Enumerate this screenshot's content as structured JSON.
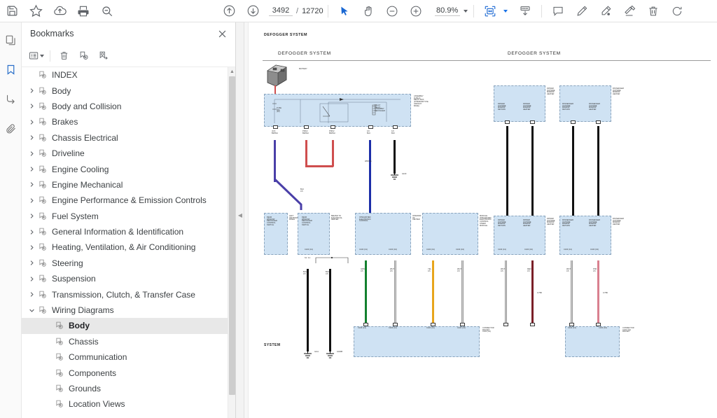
{
  "app": {
    "toolbar": {
      "left_buttons": [
        {
          "name": "save-icon",
          "label": "Save"
        },
        {
          "name": "star-icon",
          "label": "Add to favorites"
        },
        {
          "name": "cloud-upload-icon",
          "label": "Upload"
        },
        {
          "name": "print-icon",
          "label": "Print"
        },
        {
          "name": "search-minus-icon",
          "label": "Search"
        }
      ],
      "nav": {
        "previous_page_icon": "arrow-up-circle-icon",
        "next_page_icon": "arrow-down-circle-icon",
        "current_page": "3492",
        "separator": "/",
        "total_pages": "12720"
      },
      "tools": [
        {
          "name": "select-cursor-icon",
          "label": "Select"
        },
        {
          "name": "hand-pan-icon",
          "label": "Pan"
        },
        {
          "name": "zoom-out-icon",
          "label": "Zoom out"
        },
        {
          "name": "zoom-in-icon",
          "label": "Zoom in"
        }
      ],
      "zoom": {
        "value": "80.9%",
        "dropdown_icon": "chevron-down-icon"
      },
      "fit": {
        "name": "fit-page-icon",
        "label": "Fit page",
        "dropdown_icon": "chevron-down-icon"
      },
      "right_buttons": [
        {
          "name": "page-layout-icon",
          "label": "Page layout"
        },
        {
          "name": "comment-icon",
          "label": "Comment"
        },
        {
          "name": "highlight-pen-icon",
          "label": "Highlight"
        },
        {
          "name": "ink-pen-icon",
          "label": "Draw"
        },
        {
          "name": "stamp-icon",
          "label": "Stamp"
        },
        {
          "name": "trash-icon",
          "label": "Delete"
        },
        {
          "name": "rotate-icon",
          "label": "Rotate"
        }
      ]
    },
    "rail": [
      {
        "name": "rail-pages",
        "icon": "pages-icon",
        "active": false
      },
      {
        "name": "rail-bookmarks",
        "icon": "bookmark-icon",
        "active": true
      },
      {
        "name": "rail-signature",
        "icon": "signature-icon",
        "active": false
      },
      {
        "name": "rail-attachments",
        "icon": "paperclip-icon",
        "active": false
      }
    ],
    "panel": {
      "title": "Bookmarks",
      "close_icon": "close-icon",
      "tools": [
        {
          "name": "bookmark-options-icon",
          "label": "Options"
        },
        {
          "name": "delete-bookmark-icon",
          "label": "Delete bookmark"
        },
        {
          "name": "add-bookmark-icon",
          "label": "Add bookmark"
        },
        {
          "name": "goto-bookmark-icon",
          "label": "Go to bookmark"
        }
      ],
      "items": [
        {
          "label": "INDEX",
          "depth": 0,
          "expandable": false,
          "expanded": false,
          "selected": false
        },
        {
          "label": "Body",
          "depth": 0,
          "expandable": true,
          "expanded": false,
          "selected": false
        },
        {
          "label": "Body and Collision",
          "depth": 0,
          "expandable": true,
          "expanded": false,
          "selected": false
        },
        {
          "label": "Brakes",
          "depth": 0,
          "expandable": true,
          "expanded": false,
          "selected": false
        },
        {
          "label": "Chassis Electrical",
          "depth": 0,
          "expandable": true,
          "expanded": false,
          "selected": false
        },
        {
          "label": "Driveline",
          "depth": 0,
          "expandable": true,
          "expanded": false,
          "selected": false
        },
        {
          "label": "Engine Cooling",
          "depth": 0,
          "expandable": true,
          "expanded": false,
          "selected": false
        },
        {
          "label": "Engine Mechanical",
          "depth": 0,
          "expandable": true,
          "expanded": false,
          "selected": false
        },
        {
          "label": "Engine Performance & Emission Controls",
          "depth": 0,
          "expandable": true,
          "expanded": false,
          "selected": false
        },
        {
          "label": "Fuel System",
          "depth": 0,
          "expandable": true,
          "expanded": false,
          "selected": false
        },
        {
          "label": "General Information & Identification",
          "depth": 0,
          "expandable": true,
          "expanded": false,
          "selected": false
        },
        {
          "label": "Heating, Ventilation, & Air Conditioning",
          "depth": 0,
          "expandable": true,
          "expanded": false,
          "selected": false
        },
        {
          "label": "Steering",
          "depth": 0,
          "expandable": true,
          "expanded": false,
          "selected": false
        },
        {
          "label": "Suspension",
          "depth": 0,
          "expandable": true,
          "expanded": false,
          "selected": false
        },
        {
          "label": "Transmission, Clutch, & Transfer Case",
          "depth": 0,
          "expandable": true,
          "expanded": false,
          "selected": false
        },
        {
          "label": "Wiring Diagrams",
          "depth": 0,
          "expandable": true,
          "expanded": true,
          "selected": false
        },
        {
          "label": "Body",
          "depth": 1,
          "expandable": false,
          "expanded": false,
          "selected": true
        },
        {
          "label": "Chassis",
          "depth": 1,
          "expandable": false,
          "expanded": false,
          "selected": false
        },
        {
          "label": "Communication",
          "depth": 1,
          "expandable": false,
          "expanded": false,
          "selected": false
        },
        {
          "label": "Components",
          "depth": 1,
          "expandable": false,
          "expanded": false,
          "selected": false
        },
        {
          "label": "Grounds",
          "depth": 1,
          "expandable": false,
          "expanded": false,
          "selected": false
        },
        {
          "label": "Location Views",
          "depth": 1,
          "expandable": false,
          "expanded": false,
          "selected": false
        }
      ]
    },
    "splitter": {
      "collapse_icon": "collapse-left-icon"
    },
    "document": {
      "running_head": "DEFOGGER SYSTEM",
      "section_title_left": "DEFOGGER SYSTEM",
      "section_title_right": "DEFOGGER SYSTEM",
      "footer": "SYSTEM",
      "labels": {
        "battery": "BATTERY",
        "fuse_box": "ASSEMBLY\nFUSE &\nRELAY BOX\n(INTERIOR/TYPE\nVARIANT\nBASE)",
        "relay_block": "RELAY\nRELAY\nASSEMBLY\nDEFOGGER",
        "fuse_left": "FUSE\n30A\n(10)",
        "pin_a1": "(1/3)\nBR/WH",
        "pin_a2": "PNK/2\nBR/WH",
        "pin_a3": "PNK/2\nBR/WH",
        "pin_b1": "1/C\nBLU",
        "pin_b2": "1/C\nBLK",
        "splice_s1": "S1  3-1",
        "splice_label": "SPLICE",
        "gnd_main": "G100",
        "module_1": "REAR\nWINDOW\nDEFOGGER\nCONTROL\nSWITCH",
        "module_1b": "LEFT\nINSTRUMENT\nPANEL",
        "module_2": "REAR\nWINDOW\nDEFOGGER\nCONTROL\nSWITCH",
        "module_2b": "BEHIND TO\nELECTRICAL\nHEATER",
        "module_3": "INTEGRATED\nELECTRONIC\nCONTROL",
        "module_3b": "INTERIOR\nOF\nCENTER",
        "module_4": "MODULE\nINTEGRATED\nELECTRONIC\nCONTROL\nSTEER\nMODULE",
        "module_5": "DRIVER\nOUTSIDE\nMIRROR\nHEATER",
        "module_5a": "DRIVER\nOUTSIDE\nMIRROR\nRETURN",
        "module_5b": "DRIVER\nOUTSIDE\nMIRROR\nHEATER",
        "module_6": "PASSENGER\nOUTSIDE\nMIRROR\nHEATER",
        "module_6a": "PASSENGER\nOUTSIDE\nMIRROR\nRETURN",
        "module_6b": "PASSENGER\nOUTSIDE\nMIRROR\nHEATER",
        "connector_c1": "C100 (C1)",
        "connector_c2": "C100 (C2)",
        "connector_panel_left": "CONNECTOR\nPACKET\nC100 (C4)",
        "connector_panel_right": "CONNECTOR\nC100 (C4)\nPACKET",
        "wire_green": "GRN\n0.5",
        "wire_white": "WHT\n0.5",
        "wire_yellow": "YEL\n0.5",
        "wire_red": "RED\n0.5",
        "wire_pink": "PNK\n0.5",
        "gnd_a": "G111",
        "gnd_b": "G400B"
      }
    }
  },
  "colors": {
    "accent_blue": "#1967d2",
    "panel_selected": "#e8e8e8",
    "diagram_block": "#cfe2f3",
    "wire_purple": "#4a3fa8",
    "wire_red": "#cf4e4e",
    "wire_blue": "#1c2ea8",
    "wire_black": "#111111",
    "wire_green": "#12802e",
    "wire_yellow": "#e8a51c",
    "wire_darkred": "#7a1f28",
    "wire_pink": "#d9808f",
    "wire_white": "#d5d5d5"
  }
}
